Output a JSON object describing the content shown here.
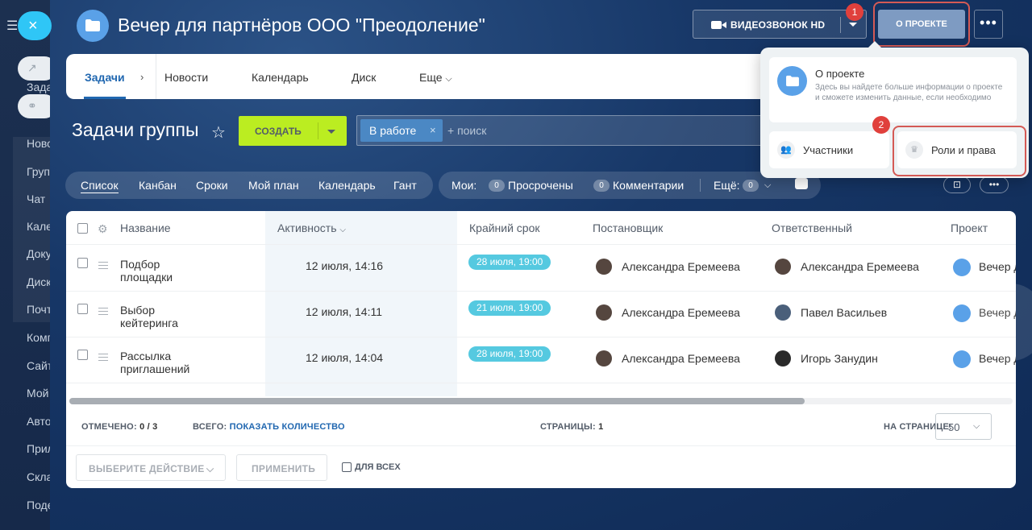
{
  "left_sidebar": {
    "items": [
      "Задачи",
      "Ново",
      "Груп",
      "Чат",
      "Кале",
      "Доку",
      "Диск",
      "Почт",
      "Комп",
      "Сайт",
      "Мой",
      "Авто",
      "Прил",
      "Скла",
      "Поде"
    ]
  },
  "project": {
    "title": "Вечер для партнёров ООО \"Преодоление\"",
    "video_call_label": "ВИДЕОЗВОНОК HD",
    "about_label": "О ПРОЕКТЕ",
    "more_label": "•••",
    "badge_1": "1",
    "badge_2": "2"
  },
  "tabs": [
    {
      "label": "Задачи"
    },
    {
      "label": "Новости"
    },
    {
      "label": "Календарь"
    },
    {
      "label": "Диск"
    },
    {
      "label": "Еще"
    }
  ],
  "toolbar": {
    "title": "Задачи группы",
    "create_label": "СОЗДАТЬ",
    "filter_chip": "В работе",
    "search_placeholder": "+ поиск"
  },
  "views": [
    "Список",
    "Канбан",
    "Сроки",
    "Мой план",
    "Календарь",
    "Гант"
  ],
  "counters": {
    "mine_label": "Мои:",
    "overdue_count": "0",
    "overdue_label": "Просрочены",
    "comments_count": "0",
    "comments_label": "Комментарии",
    "more_label": "Ещё:",
    "more_count": "0",
    "extra_more_label": "•••"
  },
  "grid": {
    "columns": [
      "Название",
      "Активность",
      "Крайний срок",
      "Постановщик",
      "Ответственный",
      "Проект"
    ],
    "rows": [
      {
        "name": "Подбор площадки",
        "activity": "12 июля, 14:16",
        "deadline": "28 июля, 19:00",
        "creator": "Александра Еремеева",
        "responsible": "Александра Еремеева",
        "project": "Вечер д"
      },
      {
        "name": "Выбор кейтеринга",
        "activity": "12 июля, 14:11",
        "deadline": "21 июля, 19:00",
        "creator": "Александра Еремеева",
        "responsible": "Павел Васильев",
        "project": "Вечер д"
      },
      {
        "name": "Рассылка приглашений",
        "activity": "12 июля, 14:04",
        "deadline": "28 июля, 19:00",
        "creator": "Александра Еремеева",
        "responsible": "Игорь Занудин",
        "project": "Вечер д"
      }
    ]
  },
  "footer": {
    "selected_label": "ОТМЕЧЕНО:",
    "selected_value": "0 / 3",
    "total_label": "ВСЕГО:",
    "show_count_link": "ПОКАЗАТЬ КОЛИЧЕСТВО",
    "pages_label": "СТРАНИЦЫ:",
    "pages_value": "1",
    "per_page_label": "НА СТРАНИЦЕ:",
    "per_page_value": "50",
    "action_select": "ВЫБЕРИТЕ ДЕЙСТВИЕ",
    "apply_label": "ПРИМЕНИТЬ",
    "for_all_label": "ДЛЯ ВСЕХ"
  },
  "popup": {
    "card_title": "О проекте",
    "card_desc": "Здесь вы найдете больше информации о проекте и сможете изменить данные, если необходимо",
    "members_label": "Участники",
    "roles_label": "Роли и права"
  },
  "colors": {
    "accent_blue": "#2067b0",
    "create_green": "#bbed21",
    "deadline_badge": "#55c9e0",
    "highlight_red": "#d45a55"
  }
}
